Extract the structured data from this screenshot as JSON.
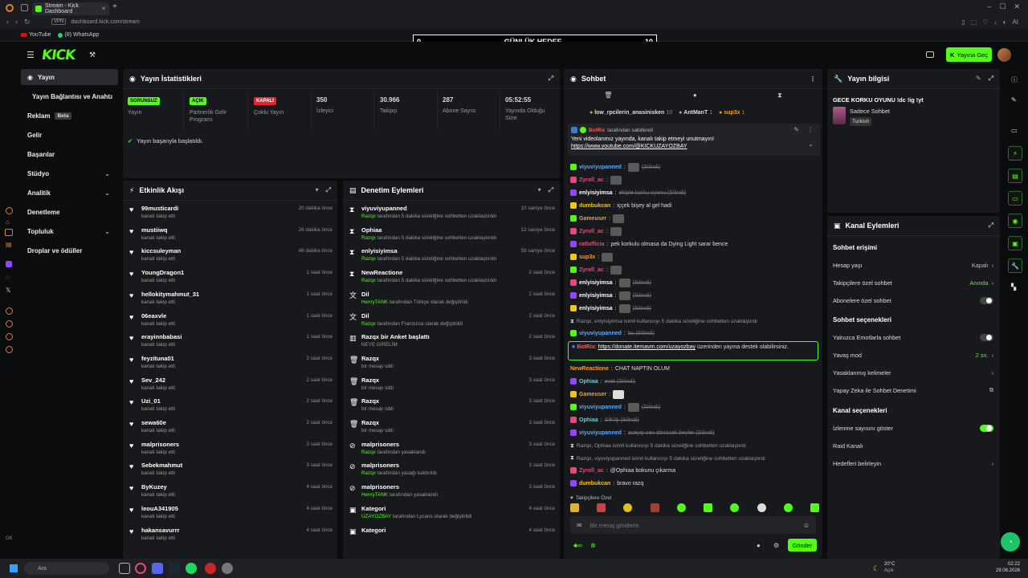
{
  "browser": {
    "tab_title": "Stream - Kick Dashboard",
    "vpn_label": "VPN",
    "url": "dashboard.kick.com/stream",
    "bookmarks": [
      "YouTube",
      "(8) WhatsApp"
    ]
  },
  "goal": {
    "left": "0",
    "title": "GÜNLÜK HEDEF",
    "right": "10"
  },
  "topbar": {
    "go_live": "Yayına Geç"
  },
  "sidebar": {
    "items": [
      {
        "label": "Yayın"
      },
      {
        "label": "Yayın Bağlantısı ve Anahtar"
      },
      {
        "label": "Reklam",
        "badge": "Beta"
      },
      {
        "label": "Gelir"
      },
      {
        "label": "Başarılar"
      },
      {
        "label": "Stüdyo"
      },
      {
        "label": "Analitik"
      },
      {
        "label": "Denetleme"
      },
      {
        "label": "Topluluk"
      },
      {
        "label": "Droplar ve ödüller"
      }
    ],
    "gk": "GK"
  },
  "stats": {
    "title": "Yayın İstatistikleri",
    "items": [
      {
        "badge": "SORUNSUZ",
        "label": "Yayın"
      },
      {
        "badge": "AÇIK",
        "label": "Partnerlik Gelir Programı"
      },
      {
        "badge": "KAPALI",
        "label": "Çoklu Yayın"
      },
      {
        "value": "350",
        "label": "İzleyici"
      },
      {
        "value": "30.966",
        "label": "Takipçi"
      },
      {
        "value": "287",
        "label": "Abone Sayısı"
      },
      {
        "value": "05:52:55",
        "label": "Yayında Olduğu Süre"
      }
    ],
    "success": "Yayın başarıyla başlatıldı."
  },
  "activity": {
    "title": "Etkinlik Akışı",
    "rows": [
      {
        "name": "99musticardi",
        "sub": "kanalı takip etti",
        "time": "20 dakika önce"
      },
      {
        "name": "mustiiwq",
        "sub": "kanalı takip etti",
        "time": "26 dakika önce"
      },
      {
        "name": "kiccsuleyman",
        "sub": "kanalı takip etti",
        "time": "48 dakika önce"
      },
      {
        "name": "YoungDragon1",
        "sub": "kanalı takip etti",
        "time": "1 saat önce"
      },
      {
        "name": "hellokitymahmut_31",
        "sub": "kanalı takip etti",
        "time": "1 saat önce"
      },
      {
        "name": "06eaxvle",
        "sub": "kanalı takip etti",
        "time": "1 saat önce"
      },
      {
        "name": "erayinnbabasi",
        "sub": "kanalı takip etti",
        "time": "1 saat önce"
      },
      {
        "name": "feyzituna01",
        "sub": "kanalı takip etti",
        "time": "2 saat önce"
      },
      {
        "name": "Sev_242",
        "sub": "kanalı takip etti",
        "time": "2 saat önce"
      },
      {
        "name": "Uzi_01",
        "sub": "kanalı takip etti",
        "time": "2 saat önce"
      },
      {
        "name": "sewa60e",
        "sub": "kanalı takip etti",
        "time": "2 saat önce"
      },
      {
        "name": "malprisoners",
        "sub": "kanalı takip etti",
        "time": "3 saat önce"
      },
      {
        "name": "Sebekmahmut",
        "sub": "kanalı takip etti",
        "time": "3 saat önce"
      },
      {
        "name": "ByKuzey",
        "sub": "kanalı takip etti",
        "time": "4 saat önce"
      },
      {
        "name": "leouA341905",
        "sub": "kanalı takip etti",
        "time": "4 saat önce"
      },
      {
        "name": "hakansavurrr",
        "sub": "kanalı takip etti",
        "time": "4 saat önce"
      }
    ]
  },
  "moderation": {
    "title": "Denetim Eylemleri",
    "rows": [
      {
        "name": "viyuviyupanned",
        "actor": "Razqx",
        "sub": "tarafından 5 dakika süreliğine sohbetten uzaklaştırıldı",
        "time": "10 saniye önce",
        "icon": "⧗"
      },
      {
        "name": "Ophiaa",
        "actor": "Razqx",
        "sub": "tarafından 5 dakika süreliğine sohbetten uzaklaştırıldı",
        "time": "12 saniye önce",
        "icon": "⧗"
      },
      {
        "name": "enlyisiyimsa",
        "actor": "Razqx",
        "sub": "tarafından 5 dakika süreliğine sohbetten uzaklaştırıldı",
        "time": "59 saniye önce",
        "icon": "⧗"
      },
      {
        "name": "NewReactione",
        "actor": "Razqx",
        "sub": "tarafından 5 dakika süreliğine sohbetten uzaklaştırıldı",
        "time": "2 saat önce",
        "icon": "⧗"
      },
      {
        "name": "Dil",
        "actor": "HenryTANK",
        "sub": "tarafından Türkçe olarak değiştirildi",
        "time": "2 saat önce",
        "icon": "文"
      },
      {
        "name": "Dil",
        "actor": "Razqx",
        "sub": "tarafından Fransızca olarak değiştirildi",
        "time": "2 saat önce",
        "icon": "文"
      },
      {
        "name": "Razqx bir Anket başlattı",
        "actor": "",
        "sub": "NEYE GİRELİM",
        "time": "2 saat önce",
        "icon": "▥"
      },
      {
        "name": "Razqx",
        "actor": "",
        "sub": "bir mesajı sildi",
        "time": "3 saat önce",
        "icon": "🗑"
      },
      {
        "name": "Razqx",
        "actor": "",
        "sub": "bir mesajı sildi",
        "time": "3 saat önce",
        "icon": "🗑"
      },
      {
        "name": "Razqx",
        "actor": "",
        "sub": "bir mesajı sildi",
        "time": "3 saat önce",
        "icon": "🗑"
      },
      {
        "name": "Razqx",
        "actor": "",
        "sub": "bir mesajı sildi",
        "time": "3 saat önce",
        "icon": "🗑"
      },
      {
        "name": "malprisoners",
        "actor": "Razqx",
        "sub": "tarafından yasaklandı",
        "time": "3 saat önce",
        "icon": "⊘"
      },
      {
        "name": "malprisoners",
        "actor": "Razqx",
        "sub": "tarafından yasağı kaldırıldı",
        "time": "3 saat önce",
        "icon": "⊘"
      },
      {
        "name": "malprisoners",
        "actor": "HenryTANK",
        "sub": "tarafından yasaklandı",
        "time": "3 saat önce",
        "icon": "⊘"
      },
      {
        "name": "Kategori",
        "actor": "UZAYOZBAY",
        "sub": "tarafından Lycans olarak değiştirildi",
        "time": "4 saat önce",
        "icon": "▣"
      },
      {
        "name": "Kategori",
        "actor": "",
        "sub": "",
        "time": "4 saat önce",
        "icon": "▣"
      }
    ]
  },
  "chat": {
    "title": "Sohbet",
    "leaderboard": [
      {
        "name": "low_rpcilerin_anasinisken",
        "count": "10"
      },
      {
        "name": "AntManT",
        "count": "1"
      },
      {
        "name": "sup3x",
        "count": "1"
      }
    ],
    "pinned_by": "BotRix",
    "pinned_suffix": "tarafından sabitlendi",
    "pinned_text": "Yeni videolarımız yayında, kanalı takip etmeyi unutmayın!",
    "pinned_link": "https://www.youtube.com/@KICKUZAYOZBAY",
    "messages": [
      {
        "user": "viyuviyupanned",
        "color": "#5aa8ff",
        "text": "(Silindi)",
        "deleted": true,
        "img": true
      },
      {
        "user": "Zyroll_ac",
        "color": "#e24a7a",
        "text": "",
        "deleted": false,
        "img": true
      },
      {
        "user": "enlyisiyimsa",
        "color": "#ffffff",
        "text": "ekiple korku oyunu (Silindi)",
        "deleted": true,
        "img": false
      },
      {
        "user": "dumbukcan",
        "color": "#f0c419",
        "text": "iççek bişey al gel hadi",
        "deleted": false,
        "img": false
      },
      {
        "user": "Gameuser",
        "color": "#f0a030",
        "text": "",
        "deleted": false,
        "img": true
      },
      {
        "user": "Zyroll_ac",
        "color": "#e24a7a",
        "text": "",
        "deleted": false,
        "img": true
      },
      {
        "user": "ratlofficia",
        "color": "#e24a7a",
        "text": "pek korkulu olmasa da Dying Light sarar bence",
        "deleted": false,
        "img": false
      },
      {
        "user": "sup3x",
        "color": "#f0a030",
        "text": "",
        "deleted": false,
        "img": true
      },
      {
        "user": "Zyroll_ac",
        "color": "#e24a7a",
        "text": "",
        "deleted": false,
        "img": true
      },
      {
        "user": "enlyisiyimsa",
        "color": "#ffffff",
        "text": "(Silindi)",
        "deleted": true,
        "img": true
      },
      {
        "user": "enlyisiyimsa",
        "color": "#ffffff",
        "text": "(Silindi)",
        "deleted": true,
        "img": true
      },
      {
        "user": "enlyisiyimsa",
        "color": "#ffffff",
        "text": "(Silindi)",
        "deleted": true,
        "img": true
      }
    ],
    "system1": "Razqx, enlyisiyimsa isimli kullanıcıyı 5 dakika süreliğine sohbetten uzaklaştırdı",
    "msg_after": {
      "user": "viyuviyupanned",
      "text": "bu (Silindi)"
    },
    "highlight_user": "BotRix",
    "highlight_link": "https://donate.itemavm.com/uzayozbay",
    "highlight_text": "üzerinden yayına destek olabilirsiniz.",
    "messages2": [
      {
        "user": "NewReactione",
        "color": "#f0a030",
        "text": "CHAT NAPTIN OLUM",
        "deleted": false
      },
      {
        "user": "Ophiaa",
        "color": "#5ad1e0",
        "text": "evet (Silindi)",
        "deleted": true
      },
      {
        "user": "Gameuser",
        "color": "#f0a030",
        "text": "",
        "deleted": false
      },
      {
        "user": "viyuviyupanned",
        "color": "#5aa8ff",
        "text": "(Silindi)",
        "deleted": true
      },
      {
        "user": "Ophiaa",
        "color": "#5ad1e0",
        "text": "SİKİŞ (Silindi)",
        "deleted": true
      },
      {
        "user": "viyuviyupanned",
        "color": "#5aa8ff",
        "text": "aceyip sex dönücek beyler (Silindi)",
        "deleted": true
      }
    ],
    "system2": "Razqx, Ophiaa isimli kullanıcıyı 5 dakika süreliğine sohbetten uzaklaştırdı",
    "system3": "Razqx, viyuviyupanned isimli kullanıcıyı 5 dakika süreliğine sohbetten uzaklaştırdı",
    "messages3": [
      {
        "user": "Zyroll_ac",
        "color": "#e24a7a",
        "text": "@Ophiaa bokunu çıkarma"
      },
      {
        "user": "dumbukcan",
        "color": "#f0c419",
        "text": "bravo razq"
      }
    ],
    "followers_only": "Takipçilere Özel",
    "input_placeholder": "Bir mesaj gönderin",
    "send": "Gönder"
  },
  "stream_info": {
    "title": "Yayın bilgisi",
    "stream_title": "GECE KORKU OYUNU !dc !ig !yt",
    "category": "Sadece Sohbet",
    "language": "Turkish"
  },
  "channel_actions": {
    "title": "Kanal Eylemleri",
    "sec1": "Sohbet erişimi",
    "rows1": [
      {
        "label": "Hesap yaşı",
        "value": "Kapalı"
      },
      {
        "label": "Takipçilere özel sohbet",
        "value": "Anında"
      },
      {
        "label": "Abonelere özel sohbet",
        "value": ""
      }
    ],
    "sec2": "Sohbet seçenekleri",
    "rows2": [
      {
        "label": "Yalnızca Emotlarla sohbet",
        "value": ""
      },
      {
        "label": "Yavaş mod",
        "value": "2 sn."
      },
      {
        "label": "Yasaklanmış kelimeler",
        "value": ""
      },
      {
        "label": "Yapay Zeka ile Sohbet Denetimi",
        "value": ""
      }
    ],
    "sec3": "Kanal seçenekleri",
    "rows3": [
      {
        "label": "İzlenme sayısını göster",
        "value": ""
      },
      {
        "label": "Raid Kanalı",
        "value": ""
      },
      {
        "label": "Hedefleri belirleyin",
        "value": ""
      }
    ]
  },
  "taskbar": {
    "search": "Ara",
    "weather_temp": "20°C",
    "weather_desc": "Açık",
    "time": "02:22",
    "date": "29.08.2026"
  },
  "colors": {
    "accent": "#53fc18",
    "bg": "#0b0c0e",
    "panel": "#18191c"
  }
}
